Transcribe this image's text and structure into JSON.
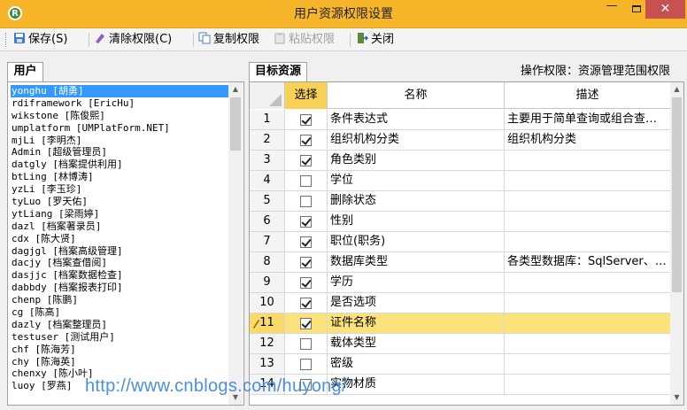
{
  "window": {
    "title": "用户资源权限设置",
    "app_icon_letter": "R",
    "close_glyph": "✕",
    "minimize_glyph": "—"
  },
  "toolbar": {
    "save_label": "保存(S)",
    "clear_label": "清除权限(C)",
    "copy_label": "复制权限",
    "paste_label": "粘贴权限",
    "close_label": "关闭"
  },
  "left_panel": {
    "tab_label": "用户",
    "users": [
      "yonghu [胡勇]",
      "rdiframework [EricHu]",
      "wikstone [陈俊熙]",
      "umplatform [UMPlatForm.NET]",
      "mjLi [李明杰]",
      "Admin [超级管理员]",
      "datgly [档案提供利用]",
      "btLing [林博涛]",
      "yzLi [李玉珍]",
      "tyLuo [罗天佑]",
      "ytLiang [梁雨婷]",
      "dazl [档案著录员]",
      "cdx [陈大贤]",
      "dagjgl [档案高级管理]",
      "dacjy [档案查借阅]",
      "dasjjc [档案数据检查]",
      "dabbdy [档案报表打印]",
      "chenp [陈鹏]",
      "cg [陈高]",
      "dazly [档案整理员]",
      "testuser [测试用户]",
      "chf [陈海芳]",
      "chy [陈海英]",
      "chenxy [陈小叶]",
      "luoy [罗燕]"
    ]
  },
  "right_panel": {
    "tab_label": "目标资源",
    "operation_permission": "操作权限：资源管理范围权限",
    "columns": {
      "select": "选择",
      "name": "名称",
      "description": "描述"
    },
    "rows": [
      {
        "num": "1",
        "checked": true,
        "name": "条件表达式",
        "description": "主要用于简单查询或组合查…"
      },
      {
        "num": "2",
        "checked": true,
        "name": "组织机构分类",
        "description": "组织机构分类"
      },
      {
        "num": "3",
        "checked": true,
        "name": "角色类别",
        "description": ""
      },
      {
        "num": "4",
        "checked": false,
        "name": "学位",
        "description": ""
      },
      {
        "num": "5",
        "checked": false,
        "name": "删除状态",
        "description": ""
      },
      {
        "num": "6",
        "checked": true,
        "name": "性别",
        "description": ""
      },
      {
        "num": "7",
        "checked": true,
        "name": "职位(职务)",
        "description": ""
      },
      {
        "num": "8",
        "checked": true,
        "name": "数据库类型",
        "description": "各类型数据库：SqlServer、…"
      },
      {
        "num": "9",
        "checked": true,
        "name": "学历",
        "description": ""
      },
      {
        "num": "10",
        "checked": true,
        "name": "是否选项",
        "description": ""
      },
      {
        "num": "11",
        "checked": true,
        "name": "证件名称",
        "description": ""
      },
      {
        "num": "12",
        "checked": false,
        "name": "载体类型",
        "description": ""
      },
      {
        "num": "13",
        "checked": false,
        "name": "密级",
        "description": ""
      },
      {
        "num": "14",
        "checked": false,
        "name": "实物材质",
        "description": ""
      }
    ],
    "current_row": "11"
  },
  "watermark": "http://www.cnblogs.com/huyong/",
  "colors": {
    "titlebar": "#f7b62a",
    "selection_blue": "#3399ff",
    "current_row": "#fbe27a",
    "select_header": "#f7d257",
    "close_button": "#c75050",
    "watermark": "#4a8fe0"
  }
}
